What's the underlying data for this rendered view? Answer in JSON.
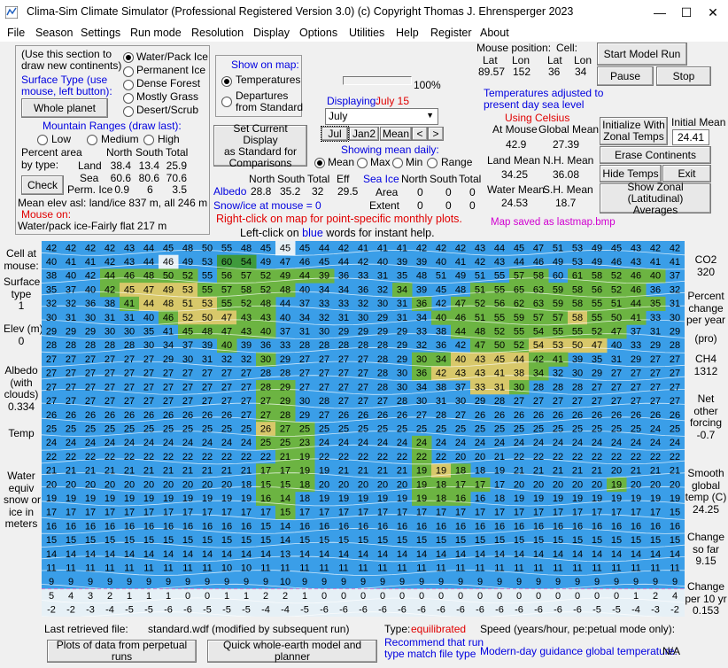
{
  "window": {
    "title": "Clima-Sim Climate Simulator (Professional Registered Version 3.0)    (c) Copyright Thomas J. Ehrensperger 2023",
    "minimize": "—",
    "maximize": "☐",
    "close": "✕"
  },
  "menu": [
    "File",
    "Season",
    "Settings",
    "Run mode",
    "Resolution",
    "Display",
    "Options",
    "Utilities",
    "Help",
    "Register",
    "About"
  ],
  "left_panel": {
    "instructions": [
      "(Use this section to",
      "draw new continents)"
    ],
    "surface_type_label": [
      "Surface Type (use",
      "mouse, left button):"
    ],
    "whole_planet": "Whole planet",
    "surface_options": [
      "Water/Pack Ice",
      "Permanent Ice",
      "Dense Forest",
      "Mostly Grass",
      "Desert/Scrub"
    ],
    "surface_selected": 0,
    "mountain_label": "Mountain Ranges (draw last):",
    "mountain_options": [
      "Low",
      "Medium",
      "High"
    ],
    "percent_area": [
      "Percent area",
      "by type:"
    ],
    "col_headers": [
      "North",
      "South",
      "Total"
    ],
    "rows": [
      {
        "label": "Land",
        "values": [
          "38.4",
          "13.4",
          "25.9"
        ]
      },
      {
        "label": "Sea",
        "values": [
          "60.6",
          "80.6",
          "70.6"
        ]
      },
      {
        "label": "Perm. Ice",
        "values": [
          "0.9",
          "6",
          "3.5"
        ]
      }
    ],
    "check": "Check",
    "mean_elev": "Mean elev asl: land/ice  837 m, all  246 m",
    "mouse_on_label": "Mouse on:",
    "mouse_on_value": "Water/pack ice-Fairly flat 217 m"
  },
  "show_on_map": {
    "label": "Show on map:",
    "options": [
      "Temperatures",
      "Departures from Standard"
    ],
    "departures_lines": [
      "Departures",
      "from Standard"
    ],
    "selected": 0
  },
  "set_standard_button": [
    "Set Current Display",
    "as Standard for",
    "Comparisons"
  ],
  "progress": {
    "value_label": "100%",
    "fraction": 1.0
  },
  "displaying": {
    "label": "Displaying:",
    "value": "July 15",
    "month_select": "July"
  },
  "nav_buttons": [
    "Jul",
    "Jan2",
    "Mean",
    "<",
    ">"
  ],
  "showing_mean": {
    "label": "Showing mean daily:",
    "options": [
      "Mean",
      "Max",
      "Min",
      "Range"
    ],
    "selected": 0
  },
  "albedo_table": {
    "headers": [
      "North",
      "South",
      "Total",
      "Eff"
    ],
    "label": "Albedo",
    "values": [
      "28.8",
      "35.2",
      "32",
      "29.5"
    ],
    "snow_label": "Snow/ice at mouse = 0"
  },
  "seaice_table": {
    "label": "Sea Ice",
    "headers": [
      "North",
      "South",
      "Total"
    ],
    "rows": [
      {
        "label": "Area",
        "values": [
          "0",
          "0",
          "0"
        ]
      },
      {
        "label": "Extent",
        "values": [
          "0",
          "0",
          "0"
        ]
      }
    ]
  },
  "right_click_hint": "Right-click on map for point-specific monthly plots.",
  "left_click_hint": [
    "Left-click on ",
    "blue",
    " words for instant help."
  ],
  "mouse_pos": {
    "label": "Mouse position:",
    "cell_label": "Cell:",
    "headers": [
      "Lat",
      "Lon",
      "Lat",
      "Lon"
    ],
    "values": [
      "89.57",
      "152",
      "36",
      "34"
    ]
  },
  "temps_adjusted": [
    "Temperatures adjusted to",
    "present day sea level"
  ],
  "using_celsius": "Using Celsius",
  "temp_summary": [
    {
      "label": "At Mouse",
      "value": "42.9",
      "label2": "Global Mean",
      "value2": "27.39"
    },
    {
      "label": "Land Mean",
      "value": "34.25",
      "label2": "N.H. Mean",
      "value2": "36.08"
    },
    {
      "label": "Water Mean",
      "value": "24.53",
      "label2": "S.H. Mean",
      "value2": "18.7"
    }
  ],
  "map_saved": "Map saved as lastmap.bmp",
  "buttons": {
    "start": "Start Model Run",
    "pause": "Pause",
    "stop": "Stop",
    "init": [
      "Initialize  With",
      "Zonal Temps"
    ],
    "erase": "Erase Continents",
    "hide": "Hide Temps",
    "exit": "Exit",
    "zonal": [
      "Show Zonal (Latitudinal)",
      "Averages"
    ]
  },
  "initial_mean": {
    "label": "Initial Mean",
    "value": "24.41"
  },
  "left_side_labels": [
    {
      "text": [
        "Cell at",
        "mouse:"
      ]
    },
    {
      "text": [
        "Surface",
        "type",
        "1"
      ]
    },
    {
      "text": [
        "Elev (m)",
        "0"
      ]
    },
    {
      "text": [
        "Albedo",
        "(with",
        "clouds)",
        "0.334"
      ]
    },
    {
      "text": [
        "Temp"
      ]
    },
    {
      "text": [
        "Water",
        "equiv",
        "snow or",
        "ice in",
        "meters"
      ]
    }
  ],
  "right_side_labels": [
    {
      "text": [
        "CO2",
        "320"
      ]
    },
    {
      "text": [
        "Percent",
        "change",
        "per year"
      ]
    },
    {
      "text": [
        "(pro)"
      ]
    },
    {
      "text": [
        "CH4",
        "1312"
      ]
    },
    {
      "text": [
        "Net",
        "other",
        "forcing",
        "-0.7"
      ]
    },
    {
      "text": [
        "Smooth",
        "global",
        "temp (C)",
        "24.25"
      ]
    },
    {
      "text": [
        "Change",
        "so far",
        "9.15"
      ]
    },
    {
      "text": [
        "Change",
        "per 10 yr",
        "0.153"
      ]
    }
  ],
  "bottom": {
    "last_file_label": "Last retrieved file:",
    "last_file": "standard.wdf (modified by subsequent run)",
    "type_label": "Type:",
    "type_value": "equilibrated",
    "recommend": [
      "Recommend that run",
      "type match file type"
    ],
    "speed": "Speed (years/hour, pe:petual mode only):",
    "guidance": "Modern-day guidance global temperature:",
    "guidance_value": "N/A",
    "plots_button": "Plots of data from perpetual runs",
    "quick_button": "Quick whole-earth model and planner"
  },
  "map": {
    "rows": [
      "42 42 42 42 43 44 45 48 50 55 48 45 45 45 44 42 41 41 41 42 42 42 43 44 45 47 51 53 49 45 43 42 42",
      "40 41 41 42 43 44 46 49 53 60 54 49 47 46 45 44 42 40 39 39 40 41 42 43 44 46 49 53 49 46 43 41 41",
      "38 40 42 44 46 48 50 52 55 56 57 52 49 44 39 36 33 31 35 48 51 49 51 55 57 58 60 61 58 52 46 40 37",
      "35 37 40 42 45 47 49 53 55 57 58 52 48 40 34 34 36 32 34 39 45 48 51 55 65 63 59 58 56 52 46 36 32",
      "32 32 36 38 41 44 48 51 53 55 52 48 44 37 33 33 32 30 31 36 42 47 52 56 62 63 59 58 55 51 44 35 31",
      "30 31 30 31 31 40 46 52 50 47 43 43 40 34 32 31 30 29 31 34 40 46 51 55 59 57 57 58 55 50 41 33 30",
      "29 29 29 30 30 35 41 45 48 47 43 40 37 31 30 29 29 29 29 33 38 44 48 52 55 54 55 55 52 47 37 31 29",
      "28 28 28 28 28 30 34 37 39 40 39 36 33 28 28 28 28 28 29 32 36 42 47 50 52 54 53 50 47 40 33 29 28",
      "27 27 27 27 27 27 29 30 31 32 32 30 29 27 27 27 27 28 29 30 34 40 43 45 44 42 41 39 35 31 29 27 27",
      "27 27 27 27 27 27 27 27 27 27 27 28 28 27 27 27 27 28 30 36 42 43 43 41 38 34 32 30 29 27 27 27 27",
      "27 27 27 27 27 27 27 27 27 27 27 28 29 27 27 27 27 28 30 34 38 37 33 31 30 28 28 28 27 27 27 27 27",
      "27 27 27 27 27 27 27 27 27 27 27 27 29 30 28 27 27 27 28 30 31 30 29 28 27 27 27 27 27 27 27 27 27",
      "26 26 26 26 26 26 26 26 26 26 27 27 28 29 27 26 26 26 26 27 28 27 26 26 26 26 26 26 26 26 26 26 26",
      "25 25 25 25 25 25 25 25 25 25 25 26 27 25 25 25 25 25 25 25 25 25 25 25 25 25 25 25 25 25 25 24 25",
      "24 24 24 24 24 24 24 24 24 24 24 25 25 23 24 24 24 24 24 24 24 24 24 24 24 24 24 24 24 24 24 24 24",
      "22 22 22 22 22 22 22 22 22 22 22 22 21 19 22 22 22 22 22 22 22 20 20 21 22 22 22 22 22 22 22 22 22",
      "21 21 21 21 21 21 21 21 21 21 21 17 17 19 19 21 21 21 21 19 19 18 18 19 21 21 21 21 21 20 21 21 21",
      "20 20 20 20 20 20 20 20 20 20 18 15 15 18 20 20 20 20 20 19 18 17 17 17 20 20 20 20 20 19 20 20 20",
      "19 19 19 19 19 19 19 19 19 19 19 16 14 18 19 19 19 19 19 19 18 16 16 18 19 19 19 19 19 19 19 19 19",
      "17 17 17 17 17 17 17 17 17 17 17 17 15 17 17 17 17 17 17 17 17 17 17 17 17 17 17 17 17 17 17 17 15",
      "16 16 16 16 16 16 16 16 16 16 16 15 14 16 16 16 16 16 16 16 16 16 16 16 16 16 16 16 16 16 16 16 16",
      "15 15 15 15 15 15 15 15 15 15 15 15 14 15 15 15 15 15 15 15 15 15 15 15 15 15 15 15 15 15 15 15 15",
      "14 14 14 14 14 14 14 14 14 14 14 14 13 14 14 14 14 14 14 14 14 14 14 14 14 14 14 14 14 14 14 14 14",
      "11 11 11 11 11 11 11 11 11 10 10 11 11 11 11 11 11 11 11 11 11 11 11 11 11 11 11 11 11 11 11 11 11",
      "9 9 9 9 9 9 9 9 9 9 9 9 10 9 9 9 9 9 9 9 9 9 9 9 9 9 9 9 9 9 9 9 9",
      "5 4 3 2 1 1 1 0 0 1 1 2 2 1 0 0 0 0 0 0 0 0 0 0 0 0 0 0 0 0 1 2 4",
      "-2 -2 -3 -4 -5 -5 -6 -6 -5 -5 -5 -4 -4 -5 -6 -6 -6 -6 -6 -6 -6 -6 -6 -6 -6 -6 -6 -6 -5 -5 -4 -3 -2"
    ],
    "land": [
      "............z...................",
      "......z..mm......................",
      "...ggggg.gggggg.........gg.ggggg..",
      "...gyyyyggggg.....g...ggggggggg...",
      "....gyyyyggg.......g.ggggggggggg..",
      "......gyyygg........gggggggyggg...",
      ".......ggggg.........ggggggggg....",
      ".........g............gggyyyy.....",
      "...........g.......ggyyyygg.......",
      "...................gyyyyyg........",
      "...........gg.........yyg.........",
      "...........gg.....................",
      "...........gg.....................",
      "...........dgg....................",
      "...........ggg.....g..............",
      "............gg.....g..............",
      "...........ggg.....gyg............",
      "...........ggg.....gggg......g....",
      "...........gg......ggg............",
      "............g.....................",
      "..................................",
      "..................................",
      "..................................",
      "..................................",
      "..................................",
      "zzzzzzzzzzzzzzzzzzzzzzzzzzzzzzzzzz",
      "zzzzzzzzzzzzzzzzzzzzzzzzzzzzzzzzzz"
    ],
    "colors": {
      "water": "#3a9ee8",
      "grass": "#6cb442",
      "forest": "#3f9a3c",
      "desert": "#d8c86a",
      "ice": "#e6f0f6",
      "contour": "#ffffff"
    }
  }
}
